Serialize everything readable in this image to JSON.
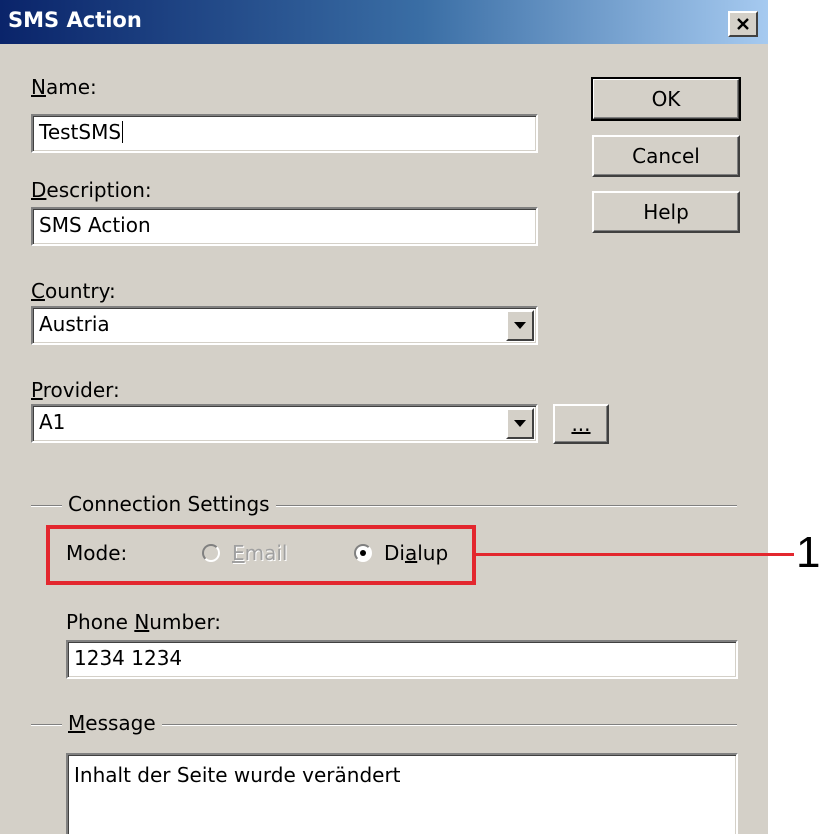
{
  "window": {
    "title": "SMS Action"
  },
  "fields": {
    "name": {
      "label_key": "N",
      "label_rest": "ame:",
      "value": "TestSMS"
    },
    "description": {
      "label_key": "D",
      "label_rest": "escription:",
      "value": "SMS Action"
    },
    "country": {
      "label_key": "C",
      "label_rest": "ountry:",
      "value": "Austria"
    },
    "provider": {
      "label_key": "P",
      "label_rest": "rovider:",
      "value": "A1"
    }
  },
  "buttons": {
    "ok": "OK",
    "cancel": "Cancel",
    "help": "Help",
    "browse_dots": "..."
  },
  "connection": {
    "group_label": "Connection Settings",
    "mode_label": "Mode:",
    "email_key": "E",
    "email_rest": "mail",
    "email_selected": false,
    "email_enabled": false,
    "dialup_pre": "Di",
    "dialup_key": "a",
    "dialup_post": "lup",
    "dialup_selected": true,
    "phone_label_pre": "Phone ",
    "phone_label_key": "N",
    "phone_label_post": "umber:",
    "phone_value": "1234 1234"
  },
  "message": {
    "group_key": "M",
    "group_rest": "essage",
    "text": "Inhalt der Seite wurde verändert"
  },
  "annotation": {
    "number": "1",
    "color": "#e3272e"
  },
  "icons": [
    "close-icon",
    "dropdown-arrow-icon",
    "scroll-up-arrow-icon"
  ]
}
